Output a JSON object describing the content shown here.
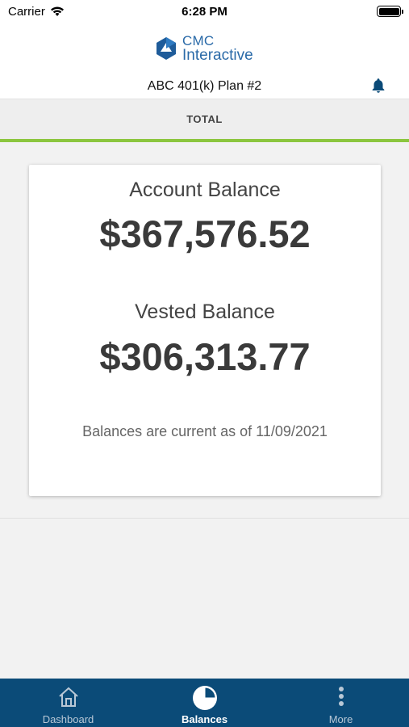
{
  "status_bar": {
    "carrier": "Carrier",
    "time": "6:28 PM"
  },
  "header": {
    "logo_line1": "CMC",
    "logo_line2": "Interactive",
    "plan_name": "ABC 401(k) Plan #2"
  },
  "tabs": {
    "active": "TOTAL"
  },
  "balances": {
    "account_label": "Account Balance",
    "account_amount": "$367,576.52",
    "vested_label": "Vested Balance",
    "vested_amount": "$306,313.77",
    "as_of_note": "Balances are current as of 11/09/2021"
  },
  "bottom_nav": {
    "items": [
      {
        "label": "Dashboard",
        "icon": "home-icon",
        "active": false
      },
      {
        "label": "Balances",
        "icon": "pie-chart-icon",
        "active": true
      },
      {
        "label": "More",
        "icon": "more-vertical-icon",
        "active": false
      }
    ]
  },
  "colors": {
    "brand_blue": "#0b4b78",
    "logo_blue": "#2a6aa8",
    "accent_green": "#8cc63f",
    "background": "#f2f2f2"
  }
}
